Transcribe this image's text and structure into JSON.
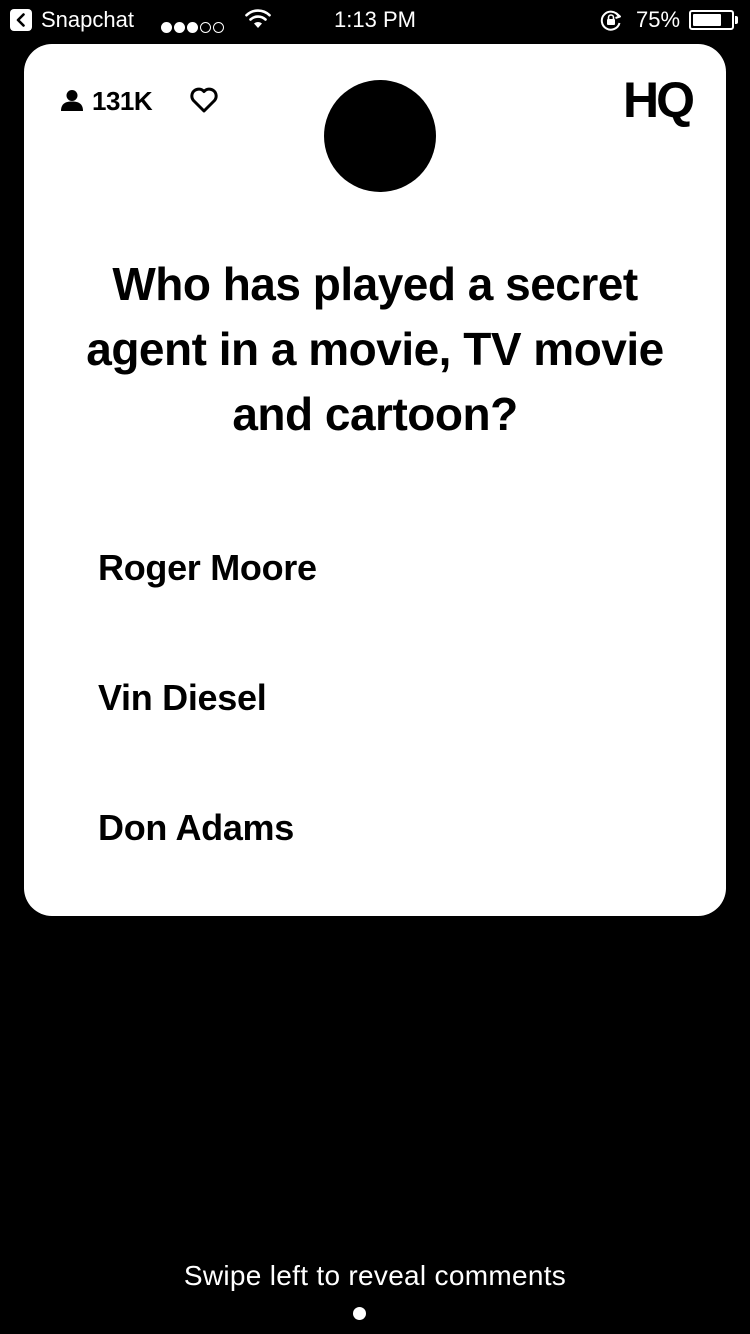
{
  "status_bar": {
    "back_app": "Snapchat",
    "signal_dots_filled": 3,
    "signal_dots_total": 5,
    "time": "1:13 PM",
    "battery_percent": "75%",
    "battery_level": 0.75
  },
  "card": {
    "viewer_count": "131K",
    "logo": "HQ",
    "question": "Who has played a secret agent in a movie, TV movie and cartoon?",
    "answers": [
      "Roger Moore",
      "Vin Diesel",
      "Don Adams"
    ]
  },
  "footer": {
    "swipe_hint": "Swipe left to reveal comments"
  },
  "colors": {
    "background": "#000000",
    "card": "#ffffff",
    "text": "#000000"
  },
  "icons": [
    "back-arrow-icon",
    "wifi-icon",
    "rotation-lock-icon",
    "battery-icon",
    "person-icon",
    "heart-icon"
  ]
}
